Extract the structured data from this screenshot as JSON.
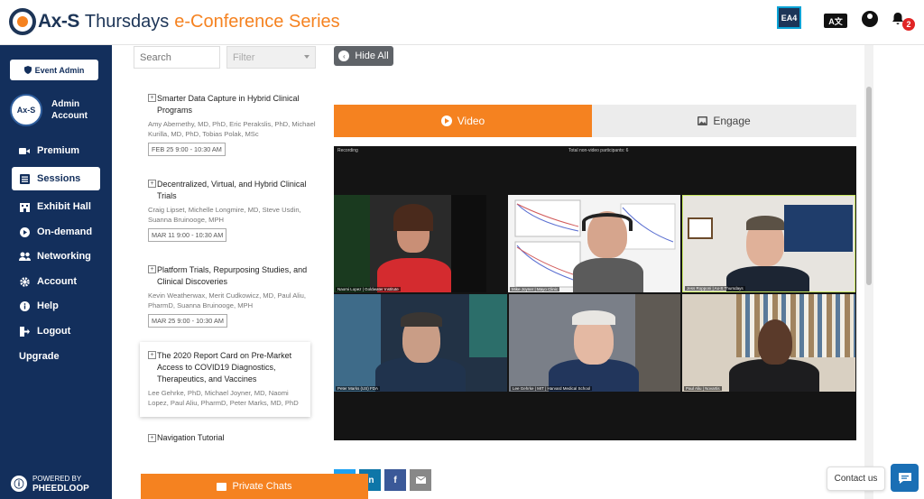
{
  "header": {
    "logo_ax": "Ax-S",
    "logo_thursdays": "Thursdays",
    "logo_series": "e-Conference Series",
    "ea4": "EA4",
    "translate": "A文",
    "notification_count": "2"
  },
  "sidebar": {
    "event_admin": "Event Admin",
    "avatar_text": "Ax-S",
    "admin_name": "Admin Account",
    "items": [
      {
        "label": "Premium",
        "icon": "video-icon"
      },
      {
        "label": "Sessions",
        "icon": "list-icon"
      },
      {
        "label": "Exhibit Hall",
        "icon": "building-icon"
      },
      {
        "label": "On-demand",
        "icon": "play-icon"
      },
      {
        "label": "Networking",
        "icon": "users-icon"
      },
      {
        "label": "Account",
        "icon": "gear-icon"
      },
      {
        "label": "Help",
        "icon": "info-icon"
      },
      {
        "label": "Logout",
        "icon": "logout-icon"
      },
      {
        "label": "Upgrade",
        "icon": ""
      }
    ],
    "powered_by": "POWERED BY",
    "pheedloop": "PHEEDLOOP"
  },
  "sessions_panel": {
    "search_placeholder": "Search",
    "filter_placeholder": "Filter",
    "sessions": [
      {
        "title": "Smarter Data Capture in Hybrid Clinical Programs",
        "speakers": "Amy Abernethy, MD, PhD, Eric Perakslis, PhD, Michael Kurilla, MD, PhD, Tobias Polak, MSc",
        "date": "FEB 25 9:00 - 10:30 AM"
      },
      {
        "title": "Decentralized, Virtual, and Hybrid Clinical Trials",
        "speakers": "Craig Lipset, Michelle Longmire, MD, Steve Usdin, Suanna Bruinooge, MPH",
        "date": "MAR 11 9:00 - 10:30 AM"
      },
      {
        "title": "Platform Trials, Repurposing Studies, and Clinical Discoveries",
        "speakers": "Kevin Weatherwax, Merit Cudkowicz, MD, Paul Aliu, PharmD, Suanna Bruinooge, MPH",
        "date": "MAR 25 9:00 - 10:30 AM"
      },
      {
        "title": "The 2020 Report Card on Pre-Market Access to COVID19 Diagnostics, Therapeutics, and Vaccines",
        "speakers": "Lee Gehrke, PhD, Michael Joyner, MD, Naomi Lopez, Paul Aliu, PharmD, Peter Marks, MD, PhD",
        "date": ""
      }
    ],
    "navigation_tutorial": "Navigation Tutorial"
  },
  "main": {
    "hide_all": "Hide All",
    "tabs": {
      "video": "Video",
      "engage": "Engage"
    },
    "video_top": {
      "recording": "Recording",
      "view": "Total non-video participants: 6"
    },
    "participants": [
      "Naomi Lopez | Goldwater Institute",
      "Mike Joyner | Mayo Clinic",
      "Jess Ropponi | Ax-S Thursdays",
      "Peter Marks (US) FDA",
      "Lee Gehrke | MIT | Harvard Medical School",
      "Paul Aliu | Novartis"
    ]
  },
  "share": {
    "linkedin": "in",
    "facebook": "f"
  },
  "footer": {
    "private_chats": "Private Chats",
    "contact_us": "Contact us"
  },
  "colors": {
    "accent": "#f58220",
    "sidebar": "#132f5c"
  }
}
